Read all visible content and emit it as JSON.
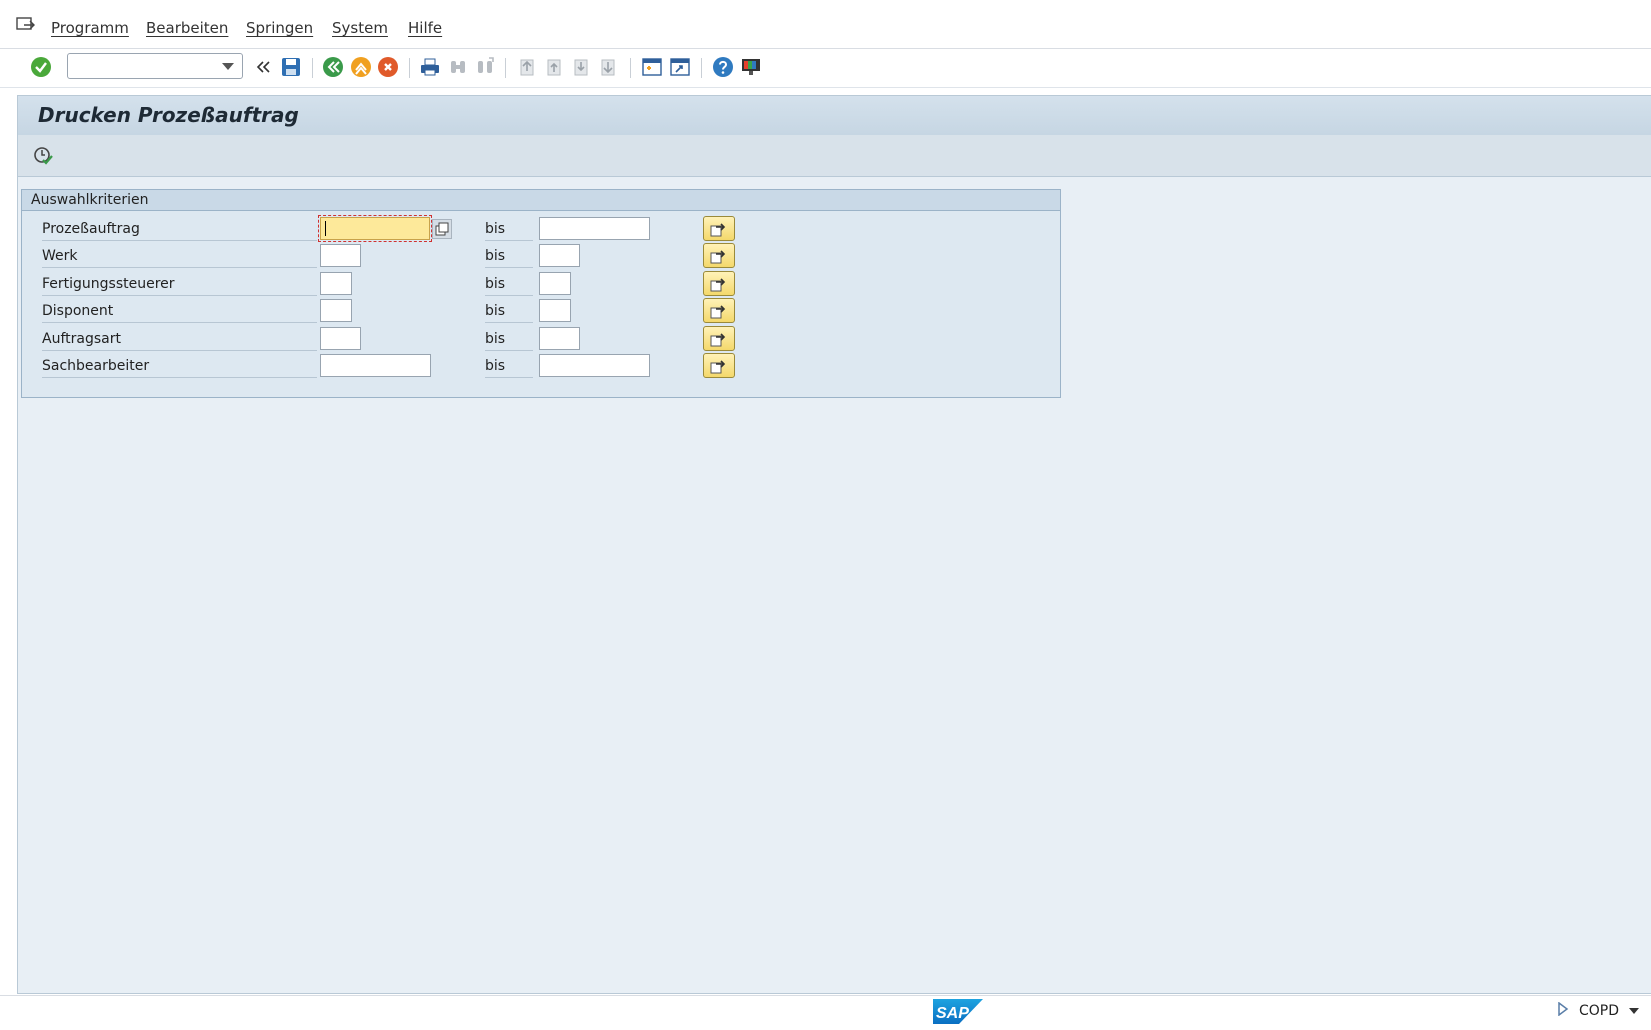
{
  "menu": {
    "items": [
      "Programm",
      "Bearbeiten",
      "Springen",
      "System",
      "Hilfe"
    ]
  },
  "toolbar": {
    "command_field_value": "",
    "icons": [
      "enter-icon",
      "back-arrows-icon",
      "save-icon",
      "back-icon",
      "exit-icon",
      "cancel-icon",
      "print-icon",
      "find-icon",
      "find-next-icon",
      "first-page-icon",
      "previous-page-icon",
      "next-page-icon",
      "last-page-icon",
      "new-session-icon",
      "create-shortcut-icon",
      "help-icon",
      "customize-layout-icon"
    ]
  },
  "screen": {
    "title": "Drucken Prozeßauftrag"
  },
  "selection": {
    "group_title": "Auswahlkriterien",
    "bis_label": "bis",
    "rows": [
      {
        "label": "Prozeßauftrag",
        "from": "",
        "to": ""
      },
      {
        "label": "Werk",
        "from": "",
        "to": ""
      },
      {
        "label": "Fertigungssteuerer",
        "from": "",
        "to": ""
      },
      {
        "label": "Disponent",
        "from": "",
        "to": ""
      },
      {
        "label": "Auftragsart",
        "from": "",
        "to": ""
      },
      {
        "label": "Sachbearbeiter",
        "from": "",
        "to": ""
      }
    ]
  },
  "status": {
    "logo_text": "SAP",
    "system": "COPD"
  },
  "colors": {
    "focus_field": "#fde99a",
    "selection_button": "#f4d86b",
    "main_background": "#e8eff5",
    "title_bar": "#c6d6e3"
  }
}
